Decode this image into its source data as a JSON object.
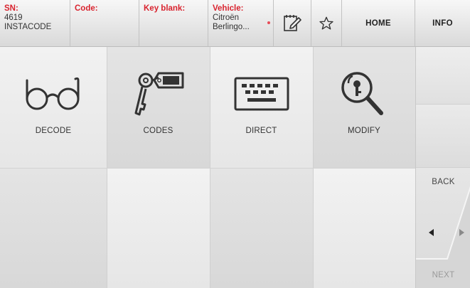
{
  "header": {
    "sn_label": "SN:",
    "sn_value_1": "4619",
    "sn_value_2": "INSTACODE",
    "code_label": "Code:",
    "code_value": "",
    "key_blank_label": "Key blank:",
    "key_blank_value": "",
    "vehicle_label": "Vehicle:",
    "vehicle_value_1": "Citroën",
    "vehicle_value_2": "Berlingo...",
    "home_label": "HOME",
    "info_label": "INFO"
  },
  "tiles": [
    {
      "label": "DECODE",
      "icon": "glasses-icon"
    },
    {
      "label": "CODES",
      "icon": "key-tag-icon"
    },
    {
      "label": "DIRECT",
      "icon": "keyboard-icon"
    },
    {
      "label": "MODIFY",
      "icon": "magnifier-key-icon"
    }
  ],
  "nav": {
    "back_label": "BACK",
    "next_label": "NEXT"
  },
  "colors": {
    "accent": "#d9232e",
    "text": "#333333",
    "disabled": "#9a9a9a"
  }
}
